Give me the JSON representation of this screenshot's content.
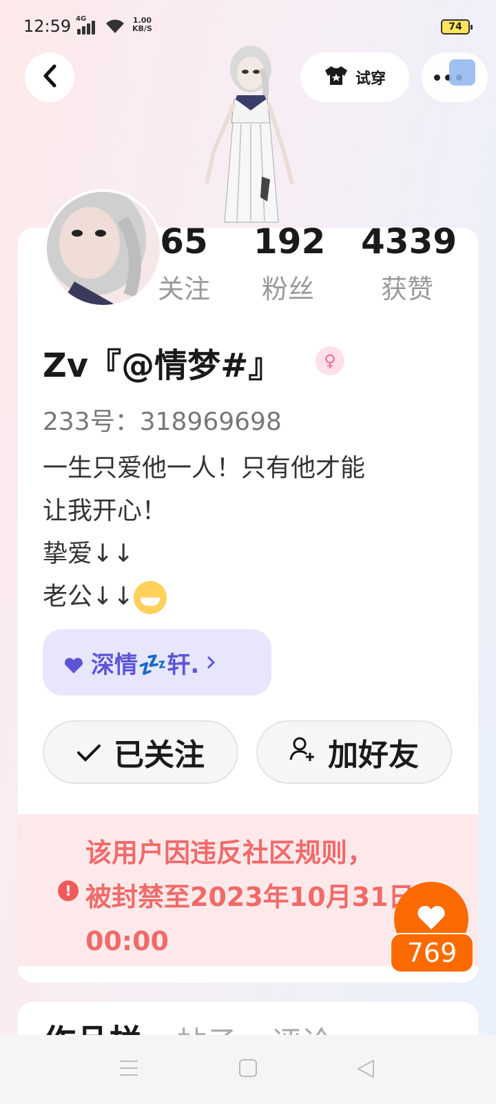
{
  "status_bar": {
    "time": "12:59",
    "network": "4G",
    "net_speed": "1.00",
    "net_speed_unit": "KB/S",
    "battery": "74"
  },
  "header": {
    "tryon_label": "试穿"
  },
  "stats": [
    {
      "value": "65",
      "label": "关注"
    },
    {
      "value": "192",
      "label": "粉丝"
    },
    {
      "value": "4339",
      "label": "获赞"
    }
  ],
  "profile": {
    "username": "Zv『@情梦#』",
    "gender_icon": "female-icon",
    "uid": "233号：318969698",
    "bio_lines": [
      "一生只爱他一人！只有他才能",
      "让我开心！",
      "挚爱↓↓",
      "老公↓↓"
    ]
  },
  "relation": {
    "label": "深情💤轩."
  },
  "actions": {
    "followed": "已关注",
    "add_friend": "加好友"
  },
  "ban_notice": {
    "line1": "该用户因违反社区规则，",
    "line2": "被封禁至2023年10月31日",
    "line3": "00:00"
  },
  "like_count": "769",
  "tabs": [
    "作品栏",
    "帖子",
    "评论"
  ],
  "colors": {
    "accent_orange": "#fb6a00",
    "ban_text": "#f06a6a",
    "chip_text": "#5b55d6"
  }
}
